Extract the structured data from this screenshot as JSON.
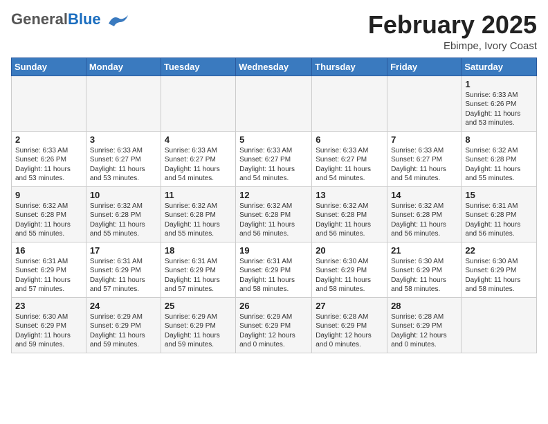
{
  "header": {
    "logo_general": "General",
    "logo_blue": "Blue",
    "month_title": "February 2025",
    "subtitle": "Ebimpe, Ivory Coast"
  },
  "days_of_week": [
    "Sunday",
    "Monday",
    "Tuesday",
    "Wednesday",
    "Thursday",
    "Friday",
    "Saturday"
  ],
  "weeks": [
    [
      {
        "day": "",
        "info": ""
      },
      {
        "day": "",
        "info": ""
      },
      {
        "day": "",
        "info": ""
      },
      {
        "day": "",
        "info": ""
      },
      {
        "day": "",
        "info": ""
      },
      {
        "day": "",
        "info": ""
      },
      {
        "day": "1",
        "info": "Sunrise: 6:33 AM\nSunset: 6:26 PM\nDaylight: 11 hours\nand 53 minutes."
      }
    ],
    [
      {
        "day": "2",
        "info": "Sunrise: 6:33 AM\nSunset: 6:26 PM\nDaylight: 11 hours\nand 53 minutes."
      },
      {
        "day": "3",
        "info": "Sunrise: 6:33 AM\nSunset: 6:27 PM\nDaylight: 11 hours\nand 53 minutes."
      },
      {
        "day": "4",
        "info": "Sunrise: 6:33 AM\nSunset: 6:27 PM\nDaylight: 11 hours\nand 54 minutes."
      },
      {
        "day": "5",
        "info": "Sunrise: 6:33 AM\nSunset: 6:27 PM\nDaylight: 11 hours\nand 54 minutes."
      },
      {
        "day": "6",
        "info": "Sunrise: 6:33 AM\nSunset: 6:27 PM\nDaylight: 11 hours\nand 54 minutes."
      },
      {
        "day": "7",
        "info": "Sunrise: 6:33 AM\nSunset: 6:27 PM\nDaylight: 11 hours\nand 54 minutes."
      },
      {
        "day": "8",
        "info": "Sunrise: 6:32 AM\nSunset: 6:28 PM\nDaylight: 11 hours\nand 55 minutes."
      }
    ],
    [
      {
        "day": "9",
        "info": "Sunrise: 6:32 AM\nSunset: 6:28 PM\nDaylight: 11 hours\nand 55 minutes."
      },
      {
        "day": "10",
        "info": "Sunrise: 6:32 AM\nSunset: 6:28 PM\nDaylight: 11 hours\nand 55 minutes."
      },
      {
        "day": "11",
        "info": "Sunrise: 6:32 AM\nSunset: 6:28 PM\nDaylight: 11 hours\nand 55 minutes."
      },
      {
        "day": "12",
        "info": "Sunrise: 6:32 AM\nSunset: 6:28 PM\nDaylight: 11 hours\nand 56 minutes."
      },
      {
        "day": "13",
        "info": "Sunrise: 6:32 AM\nSunset: 6:28 PM\nDaylight: 11 hours\nand 56 minutes."
      },
      {
        "day": "14",
        "info": "Sunrise: 6:32 AM\nSunset: 6:28 PM\nDaylight: 11 hours\nand 56 minutes."
      },
      {
        "day": "15",
        "info": "Sunrise: 6:31 AM\nSunset: 6:28 PM\nDaylight: 11 hours\nand 56 minutes."
      }
    ],
    [
      {
        "day": "16",
        "info": "Sunrise: 6:31 AM\nSunset: 6:29 PM\nDaylight: 11 hours\nand 57 minutes."
      },
      {
        "day": "17",
        "info": "Sunrise: 6:31 AM\nSunset: 6:29 PM\nDaylight: 11 hours\nand 57 minutes."
      },
      {
        "day": "18",
        "info": "Sunrise: 6:31 AM\nSunset: 6:29 PM\nDaylight: 11 hours\nand 57 minutes."
      },
      {
        "day": "19",
        "info": "Sunrise: 6:31 AM\nSunset: 6:29 PM\nDaylight: 11 hours\nand 58 minutes."
      },
      {
        "day": "20",
        "info": "Sunrise: 6:30 AM\nSunset: 6:29 PM\nDaylight: 11 hours\nand 58 minutes."
      },
      {
        "day": "21",
        "info": "Sunrise: 6:30 AM\nSunset: 6:29 PM\nDaylight: 11 hours\nand 58 minutes."
      },
      {
        "day": "22",
        "info": "Sunrise: 6:30 AM\nSunset: 6:29 PM\nDaylight: 11 hours\nand 58 minutes."
      }
    ],
    [
      {
        "day": "23",
        "info": "Sunrise: 6:30 AM\nSunset: 6:29 PM\nDaylight: 11 hours\nand 59 minutes."
      },
      {
        "day": "24",
        "info": "Sunrise: 6:29 AM\nSunset: 6:29 PM\nDaylight: 11 hours\nand 59 minutes."
      },
      {
        "day": "25",
        "info": "Sunrise: 6:29 AM\nSunset: 6:29 PM\nDaylight: 11 hours\nand 59 minutes."
      },
      {
        "day": "26",
        "info": "Sunrise: 6:29 AM\nSunset: 6:29 PM\nDaylight: 12 hours\nand 0 minutes."
      },
      {
        "day": "27",
        "info": "Sunrise: 6:28 AM\nSunset: 6:29 PM\nDaylight: 12 hours\nand 0 minutes."
      },
      {
        "day": "28",
        "info": "Sunrise: 6:28 AM\nSunset: 6:29 PM\nDaylight: 12 hours\nand 0 minutes."
      },
      {
        "day": "",
        "info": ""
      }
    ]
  ]
}
